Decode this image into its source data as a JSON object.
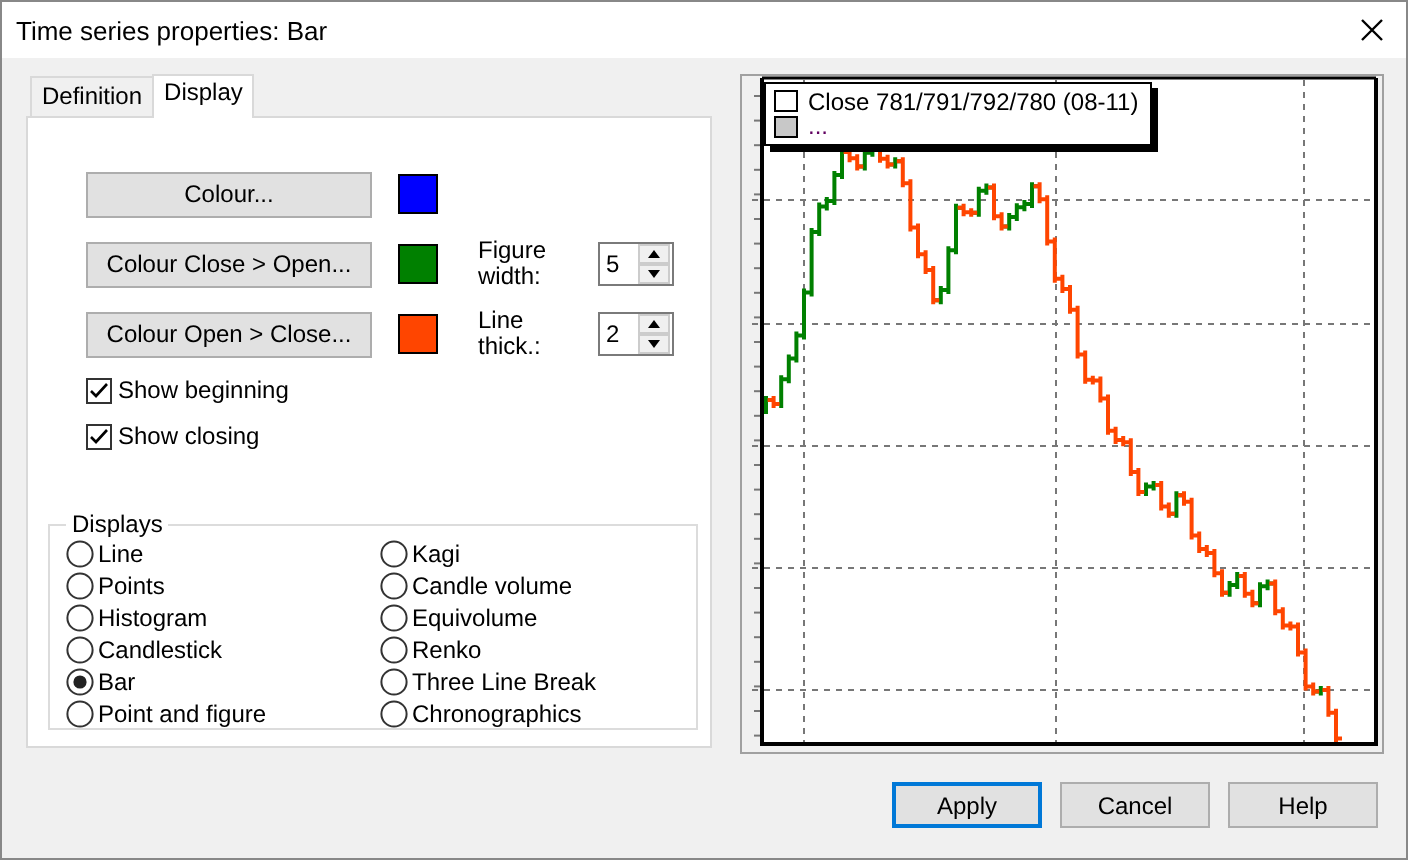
{
  "window": {
    "title": "Time series properties: Bar"
  },
  "tabs": [
    {
      "label": "Definition",
      "selected": false
    },
    {
      "label": "Display",
      "selected": true
    }
  ],
  "colour_rows": [
    {
      "button": "Colour...",
      "color": "#0000ff"
    },
    {
      "button": "Colour Close > Open...",
      "color": "#008000",
      "spinner": {
        "label": "Figure width:",
        "value": "5"
      }
    },
    {
      "button": "Colour Open > Close...",
      "color": "#ff4500",
      "spinner": {
        "label": "Line thick.:",
        "value": "2"
      }
    }
  ],
  "checkboxes": [
    {
      "label": "Show beginning",
      "checked": true
    },
    {
      "label": "Show closing",
      "checked": true
    }
  ],
  "displays": {
    "title": "Displays",
    "options": [
      {
        "label": "Line",
        "selected": false
      },
      {
        "label": "Points",
        "selected": false
      },
      {
        "label": "Histogram",
        "selected": false
      },
      {
        "label": "Candlestick",
        "selected": false
      },
      {
        "label": "Bar",
        "selected": true
      },
      {
        "label": "Point and figure",
        "selected": false
      },
      {
        "label": "Kagi",
        "selected": false
      },
      {
        "label": "Candle volume",
        "selected": false
      },
      {
        "label": "Equivolume",
        "selected": false
      },
      {
        "label": "Renko",
        "selected": false
      },
      {
        "label": "Three Line Break",
        "selected": false
      },
      {
        "label": "Chronographics",
        "selected": false
      }
    ]
  },
  "preview": {
    "legend": [
      {
        "label": "Close 781/791/792/780 (08-11)",
        "color": "#ffffff"
      },
      {
        "label": "...",
        "color": "#c8c8c8"
      }
    ]
  },
  "buttons": [
    {
      "label": "Apply",
      "default": true
    },
    {
      "label": "Cancel",
      "default": false
    },
    {
      "label": "Help",
      "default": false
    }
  ]
}
